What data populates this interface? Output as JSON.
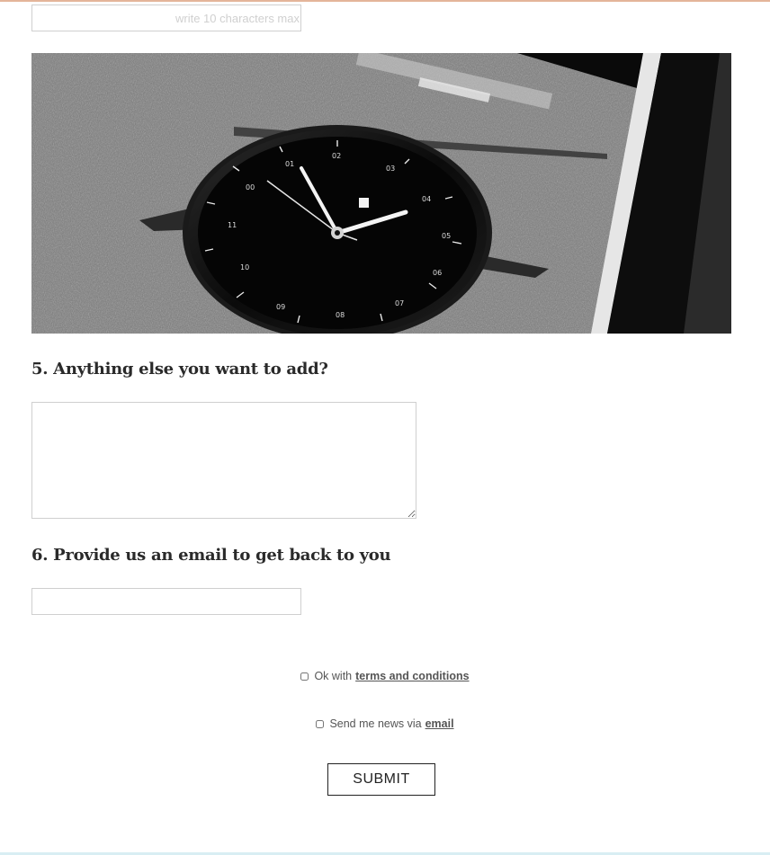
{
  "form": {
    "short_field": {
      "value": "",
      "placeholder": "write 10 characters max"
    },
    "question5": {
      "title": "5. Anything else you want to add?",
      "value": ""
    },
    "question6": {
      "title": "6. Provide us an email to get back to you",
      "value": ""
    },
    "terms": {
      "prefix": "Ok with",
      "link": "terms and conditions"
    },
    "news": {
      "prefix": "Send me news via",
      "link": "email"
    },
    "submit_label": "SUBMIT"
  },
  "colors": {
    "top_rule": "#e4b59a",
    "bottom_rule": "#d8eef3",
    "field_border": "#cfcfcf"
  }
}
